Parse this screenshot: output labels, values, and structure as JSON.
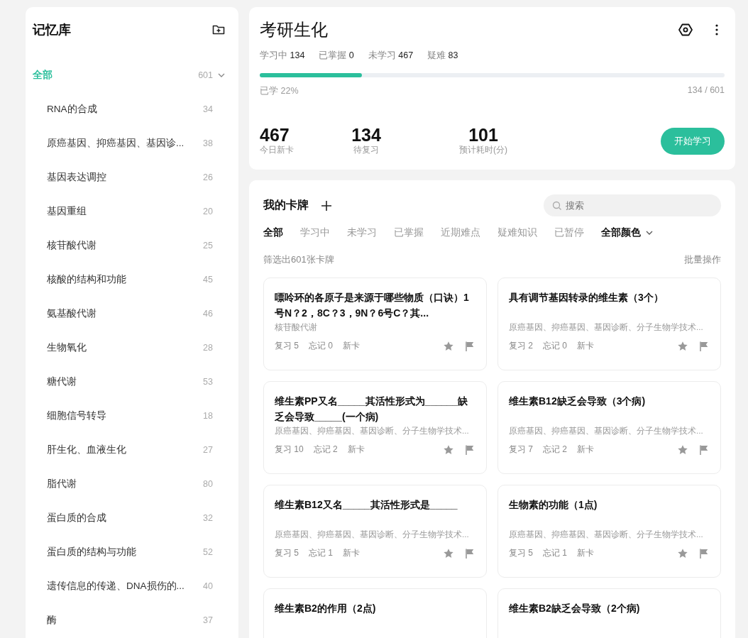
{
  "sidebar": {
    "title": "记忆库",
    "root": {
      "label": "全部",
      "count": "601",
      "selected": true,
      "expanded": true,
      "children": [
        {
          "label": "RNA的合成",
          "count": "34",
          "selected": false
        },
        {
          "label": "原癌基因、抑癌基因、基因诊...",
          "count": "38",
          "selected": false
        },
        {
          "label": "基因表达调控",
          "count": "26",
          "selected": false
        },
        {
          "label": "基因重组",
          "count": "20",
          "selected": false
        },
        {
          "label": "核苷酸代谢",
          "count": "25",
          "selected": false
        },
        {
          "label": "核酸的结构和功能",
          "count": "45",
          "selected": false
        },
        {
          "label": "氨基酸代谢",
          "count": "46",
          "selected": false
        },
        {
          "label": "生物氧化",
          "count": "28",
          "selected": false
        },
        {
          "label": "糖代谢",
          "count": "53",
          "selected": false
        },
        {
          "label": "细胞信号转导",
          "count": "18",
          "selected": false
        },
        {
          "label": "肝生化、血液生化",
          "count": "27",
          "selected": false
        },
        {
          "label": "脂代谢",
          "count": "80",
          "selected": false
        },
        {
          "label": "蛋白质的合成",
          "count": "32",
          "selected": false
        },
        {
          "label": "蛋白质的结构与功能",
          "count": "52",
          "selected": false
        },
        {
          "label": "遗传信息的传递、DNA损伤的...",
          "count": "40",
          "selected": false
        },
        {
          "label": "酶",
          "count": "37",
          "selected": false
        }
      ]
    }
  },
  "deck": {
    "title": "考研生化",
    "status": [
      {
        "label": "学习中",
        "value": "134"
      },
      {
        "label": "已掌握",
        "value": "0"
      },
      {
        "label": "未学习",
        "value": "467"
      },
      {
        "label": "疑难",
        "value": "83"
      }
    ],
    "progress": {
      "level": 0.22,
      "label": "已学 22%",
      "reading": "134 / 601"
    },
    "stats": [
      {
        "value": "467",
        "label": "今日新卡"
      },
      {
        "value": "134",
        "label": "待复习"
      },
      {
        "value": "101",
        "label": "预计耗时(分)"
      }
    ],
    "start_button": "开始学习"
  },
  "cards_panel": {
    "title": "我的卡牌",
    "search": {
      "placeholder": "搜索"
    },
    "filters": [
      {
        "label": "全部",
        "selected": true
      },
      {
        "label": "学习中",
        "selected": false
      },
      {
        "label": "未学习",
        "selected": false
      },
      {
        "label": "已掌握",
        "selected": false
      },
      {
        "label": "近期难点",
        "selected": false
      },
      {
        "label": "疑难知识",
        "selected": false
      },
      {
        "label": "已暂停",
        "selected": false
      }
    ],
    "color_filter": "全部颜色",
    "summary": "筛选出601张卡牌",
    "batch_action": "批量操作",
    "cards": [
      {
        "title": "嘌呤环的各原子是来源于哪些物质（口诀）1号N？2，8C？3，9N？6号C？其...",
        "tag": "核苷酸代谢",
        "review": "复习 5",
        "forget": "忘记 0",
        "status": "新卡"
      },
      {
        "title": "具有调节基因转录的维生素（3个）",
        "tag": "原癌基因、抑癌基因、基因诊断、分子生物学技术...",
        "review": "复习 2",
        "forget": "忘记 0",
        "status": "新卡"
      },
      {
        "title": "维生素PP又名_____其活性形式为______缺乏会导致_____(一个病)",
        "tag": "原癌基因、抑癌基因、基因诊断、分子生物学技术...",
        "review": "复习 10",
        "forget": "忘记 2",
        "status": "新卡"
      },
      {
        "title": "维生素B12缺乏会导致（3个病)",
        "tag": "原癌基因、抑癌基因、基因诊断、分子生物学技术...",
        "review": "复习 7",
        "forget": "忘记 2",
        "status": "新卡"
      },
      {
        "title": "维生素B12又名_____其活性形式是_____",
        "tag": "原癌基因、抑癌基因、基因诊断、分子生物学技术...",
        "review": "复习 5",
        "forget": "忘记 1",
        "status": "新卡"
      },
      {
        "title": "生物素的功能（1点)",
        "tag": "原癌基因、抑癌基因、基因诊断、分子生物学技术...",
        "review": "复习 5",
        "forget": "忘记 1",
        "status": "新卡"
      },
      {
        "title": "维生素B2的作用（2点)"
      },
      {
        "title": "维生素B2缺乏会导致（2个病)"
      }
    ]
  }
}
